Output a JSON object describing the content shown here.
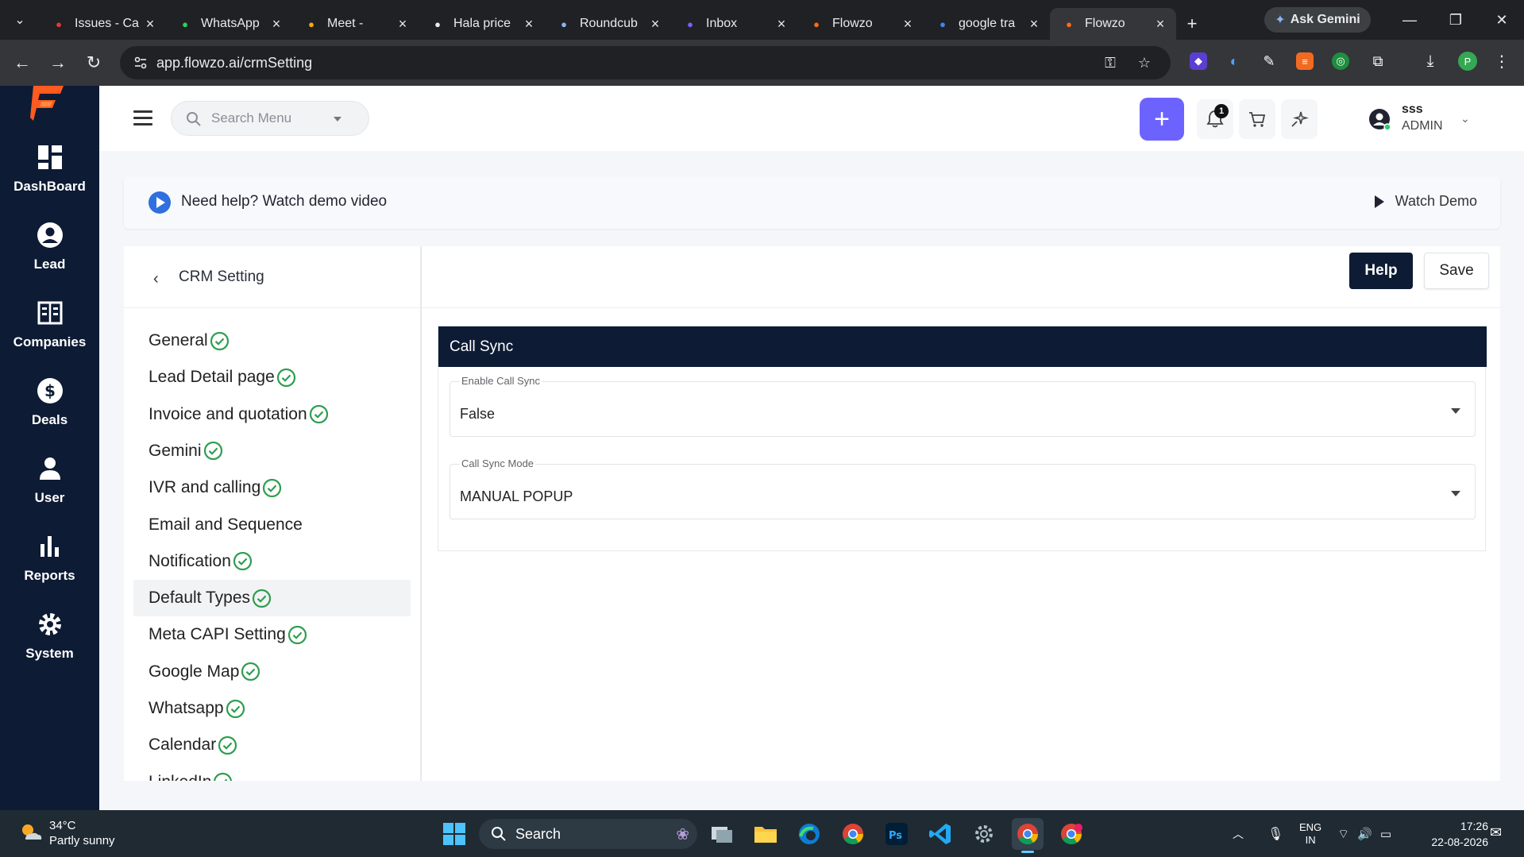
{
  "browser": {
    "tabs": [
      {
        "title": "Issues - Ca",
        "icon": "issues-icon",
        "color": "#e53935"
      },
      {
        "title": "WhatsApp",
        "icon": "whatsapp-icon",
        "color": "#25d366"
      },
      {
        "title": "Meet -",
        "icon": "meet-icon",
        "color": "#f9ab00"
      },
      {
        "title": "Hala price",
        "icon": "openai-icon",
        "color": "#e8eaed"
      },
      {
        "title": "Roundcub",
        "icon": "roundcube-icon",
        "color": "#8ab4f8"
      },
      {
        "title": "Inbox",
        "icon": "yahoo-icon",
        "color": "#7b61ff"
      },
      {
        "title": "Flowzo",
        "icon": "flowzo-icon",
        "color": "#ff6a13"
      },
      {
        "title": "google tra",
        "icon": "google-icon",
        "color": "#4285f4"
      },
      {
        "title": "Flowzo",
        "icon": "flowzo-icon",
        "color": "#ff6a13"
      }
    ],
    "ask_gemini": "Ask Gemini",
    "url": "app.flowzo.ai/crmSetting",
    "profile_initial": "P"
  },
  "rail": {
    "items": [
      {
        "label": "DashBoard",
        "icon": "dashboard-icon"
      },
      {
        "label": "Lead",
        "icon": "lead-icon"
      },
      {
        "label": "Companies",
        "icon": "companies-icon"
      },
      {
        "label": "Deals",
        "icon": "deals-icon"
      },
      {
        "label": "User",
        "icon": "user-icon"
      },
      {
        "label": "Reports",
        "icon": "reports-icon"
      },
      {
        "label": "System",
        "icon": "system-icon"
      }
    ]
  },
  "topbar": {
    "search_placeholder": "Search Menu",
    "notification_count": "1",
    "user": {
      "name": "sss",
      "role": "ADMIN"
    }
  },
  "banner": {
    "text": "Need help? Watch demo video",
    "watch_label": "Watch Demo"
  },
  "settings": {
    "title": "CRM Setting",
    "items": [
      {
        "label": "General",
        "checked": true
      },
      {
        "label": "Lead Detail page",
        "checked": true
      },
      {
        "label": "Invoice and quotation",
        "checked": true
      },
      {
        "label": "Gemini",
        "checked": true
      },
      {
        "label": "IVR and calling",
        "checked": true
      },
      {
        "label": "Email and Sequence",
        "checked": false
      },
      {
        "label": "Notification",
        "checked": true
      },
      {
        "label": "Default Types",
        "checked": true,
        "selected": true
      },
      {
        "label": "Meta CAPI Setting",
        "checked": true
      },
      {
        "label": "Google Map",
        "checked": true
      },
      {
        "label": "Whatsapp",
        "checked": true
      },
      {
        "label": "Calendar",
        "checked": true
      },
      {
        "label": "LinkedIn",
        "checked": true
      }
    ]
  },
  "main": {
    "help_label": "Help",
    "save_label": "Save",
    "section_title": "Call Sync",
    "fields": [
      {
        "label": "Enable Call Sync",
        "value": "False"
      },
      {
        "label": "Call Sync Mode",
        "value": "MANUAL POPUP"
      }
    ]
  },
  "taskbar": {
    "weather_temp": "34°C",
    "weather_desc": "Partly sunny",
    "search_label": "Search",
    "lang_top": "ENG",
    "lang_bottom": "IN",
    "time": "17:26",
    "date": "22-08-2026"
  },
  "colors": {
    "navy": "#0d1b34",
    "accent_purple": "#6c63ff",
    "check_green": "#2e9e4f",
    "brand_orange": "#ff5a1f"
  }
}
